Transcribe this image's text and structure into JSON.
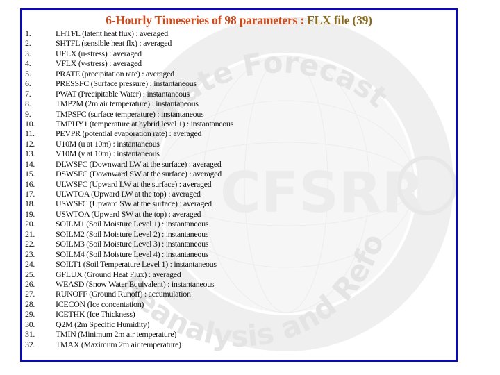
{
  "title": {
    "main": "6-Hourly Timeseries of 98 parameters : ",
    "highlight": "FLX file (39)",
    "main_color": "#cc4a1c",
    "highlight_color": "#8a6a1c"
  },
  "frame_color": "#0a0ab4",
  "watermark": {
    "top_text": "Climate Forecast System",
    "center_text": "CFSRR",
    "bottom_text": "Reanalysis and Reforecast"
  },
  "parameters": [
    {
      "num": "1.",
      "text": "LHTFL (latent heat flux) : averaged"
    },
    {
      "num": "2.",
      "text": "SHTFL (sensible heat flx) : averaged"
    },
    {
      "num": "3.",
      "text": "UFLX (u-stress) : averaged"
    },
    {
      "num": "4.",
      "text": "VFLX (v-stress) : averaged"
    },
    {
      "num": "5.",
      "text": "PRATE (precipitation rate) : averaged"
    },
    {
      "num": "6.",
      "text": "PRESSFC (Surface pressure) : instantaneous"
    },
    {
      "num": "7.",
      "text": "PWAT (Precipitable Water) : instantaneous"
    },
    {
      "num": "8.",
      "text": "TMP2M (2m air temperature) : instantaneous"
    },
    {
      "num": "9.",
      "text": "TMPSFC (surface temperature) : instantaneous"
    },
    {
      "num": "10.",
      "text": "TMPHY1 (temperature at hybrid level 1) : instantaneous"
    },
    {
      "num": "11.",
      "text": "PEVPR (potential evaporation rate) : averaged"
    },
    {
      "num": "12.",
      "text": "U10M (u at 10m) : instantaneous"
    },
    {
      "num": "13.",
      "text": "V10M (v at 10m) : instantaneous"
    },
    {
      "num": "14.",
      "text": "DLWSFC (Downward LW at the surface) : averaged"
    },
    {
      "num": "15.",
      "text": "DSWSFC (Downward SW at the surface) : averaged"
    },
    {
      "num": "16.",
      "text": "ULWSFC (Upward LW at the surface) : averaged"
    },
    {
      "num": "17.",
      "text": "ULWTOA (Upward LW at the top) : averaged"
    },
    {
      "num": "18.",
      "text": "USWSFC (Upward SW at the surface) : averaged"
    },
    {
      "num": "19.",
      "text": "USWTOA (Upward SW at the top) : averaged"
    },
    {
      "num": "20.",
      "text": "SOILM1 (Soil Moisture Level 1) : instantaneous"
    },
    {
      "num": "21.",
      "text": "SOILM2 (Soil Moisture Level 2) : instantaneous"
    },
    {
      "num": "22.",
      "text": "SOILM3 (Soil Moisture Level 3) : instantaneous"
    },
    {
      "num": "23.",
      "text": "SOILM4 (Soil Moisture Level 4) : instantaneous"
    },
    {
      "num": "24.",
      "text": "SOILT1 (Soil Temperature Level 1) : instantaneous"
    },
    {
      "num": "25.",
      "text": "GFLUX (Ground Heat Flux) : averaged"
    },
    {
      "num": "26.",
      "text": "WEASD (Snow Water Equivalent) : instantaneous"
    },
    {
      "num": "27.",
      "text": "RUNOFF (Ground Runoff) : accumulation"
    },
    {
      "num": "28.",
      "text": "ICECON (Ice concentation)"
    },
    {
      "num": "29.",
      "text": "ICETHK (Ice Thickness)"
    },
    {
      "num": "30.",
      "text": "Q2M (2m Specific Humidity)"
    },
    {
      "num": "31.",
      "text": "TMIN (Minimum 2m air temperature)"
    },
    {
      "num": "32.",
      "text": "TMAX (Maximum 2m air temperature)"
    }
  ]
}
